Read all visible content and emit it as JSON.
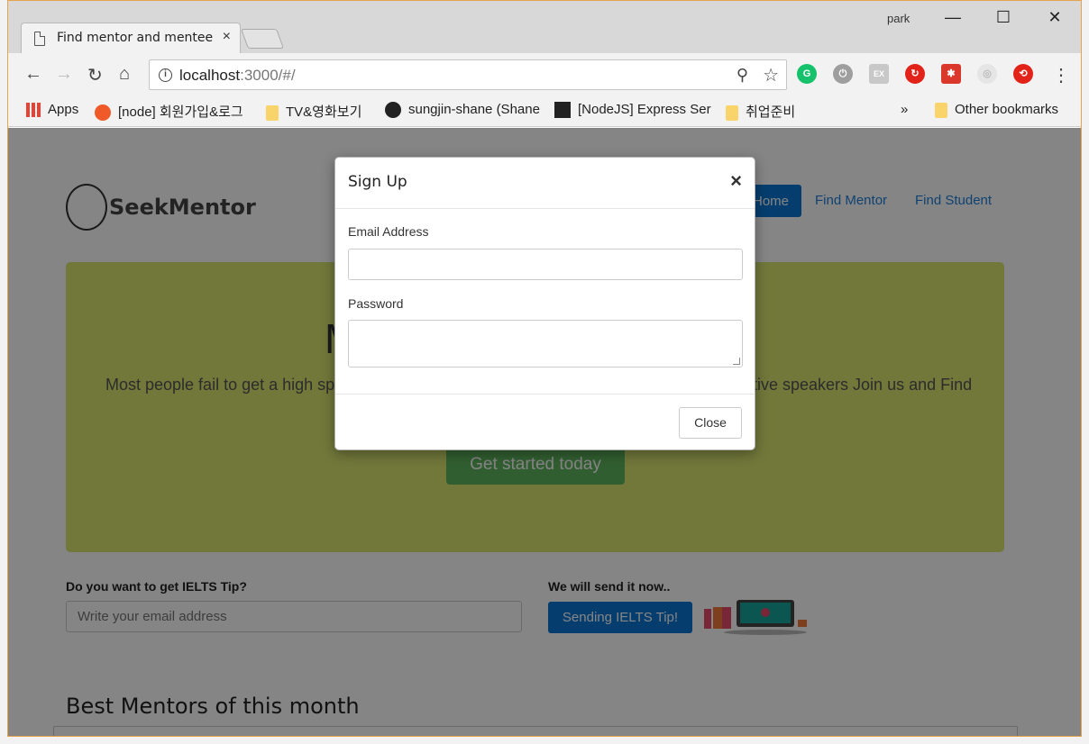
{
  "browser": {
    "tab_title": "Find mentor and mentee",
    "tab_close": "×",
    "profile_name": "park",
    "url_host": "localhost",
    "url_path": ":3000/#/",
    "bookmarks": [
      {
        "label": "Apps"
      },
      {
        "label": "[node] 회원가입&로그"
      },
      {
        "label": "TV&영화보기"
      },
      {
        "label": "sungjin-shane (Shane"
      },
      {
        "label": "[NodeJS] Express Ser"
      },
      {
        "label": "취업준비"
      }
    ],
    "bookmarks_overflow": "»",
    "other_bookmarks": "Other bookmarks"
  },
  "site": {
    "logo_text": "SeekMentor",
    "nav": {
      "home": "Home",
      "find_mentor": "Find Mentor",
      "find_student": "Find Student"
    },
    "hero": {
      "title_partial": "M",
      "text_left": "Most people fail to get a high sp",
      "text_right": "tive speakers Join us and Find",
      "cta": "Get started today"
    },
    "ielts": {
      "question": "Do you want to get IELTS Tip?",
      "placeholder": "Write your email address",
      "send_label": "We will send it now..",
      "button": "Sending IELTS Tip!"
    },
    "section_title": "Best Mentors of this month"
  },
  "modal": {
    "title": "Sign Up",
    "close_x": "×",
    "email_label": "Email Address",
    "password_label": "Password",
    "close_button": "Close"
  },
  "colors": {
    "primary": "#0b77d4",
    "hero_bg": "#d9e66f",
    "cta": "#5fb45d"
  }
}
